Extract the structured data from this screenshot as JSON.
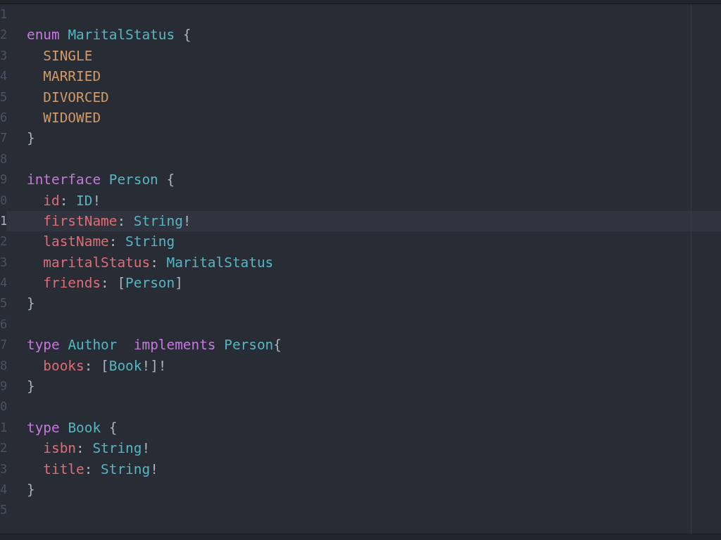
{
  "editor": {
    "lines": [
      {
        "number": "1",
        "highlighted": false
      },
      {
        "number": "2",
        "highlighted": false,
        "tokens": [
          {
            "kind": "keyword",
            "text": "enum"
          },
          {
            "kind": "type",
            "text": " MaritalStatus"
          },
          {
            "kind": "punct",
            "text": " {"
          }
        ]
      },
      {
        "number": "3",
        "highlighted": false,
        "tokens": [
          {
            "kind": "enumvalue",
            "text": "  SINGLE"
          }
        ]
      },
      {
        "number": "4",
        "highlighted": false,
        "tokens": [
          {
            "kind": "enumvalue",
            "text": "  MARRIED"
          }
        ]
      },
      {
        "number": "5",
        "highlighted": false,
        "tokens": [
          {
            "kind": "enumvalue",
            "text": "  DIVORCED"
          }
        ]
      },
      {
        "number": "6",
        "highlighted": false,
        "tokens": [
          {
            "kind": "enumvalue",
            "text": "  WIDOWED"
          }
        ]
      },
      {
        "number": "7",
        "highlighted": false,
        "tokens": [
          {
            "kind": "punct",
            "text": "}"
          }
        ]
      },
      {
        "number": "8",
        "highlighted": false
      },
      {
        "number": "9",
        "highlighted": false,
        "tokens": [
          {
            "kind": "keyword",
            "text": "interface"
          },
          {
            "kind": "type",
            "text": " Person"
          },
          {
            "kind": "punct",
            "text": " {"
          }
        ]
      },
      {
        "number": "0",
        "highlighted": false,
        "tokens": [
          {
            "kind": "field",
            "text": "  id"
          },
          {
            "kind": "punct",
            "text": ":"
          },
          {
            "kind": "type",
            "text": " ID"
          },
          {
            "kind": "punct",
            "text": "!"
          }
        ]
      },
      {
        "number": "1",
        "highlighted": true,
        "tokens": [
          {
            "kind": "field",
            "text": "  firstName"
          },
          {
            "kind": "punct",
            "text": ":"
          },
          {
            "kind": "type",
            "text": " String"
          },
          {
            "kind": "punct",
            "text": "!"
          }
        ]
      },
      {
        "number": "2",
        "highlighted": false,
        "tokens": [
          {
            "kind": "field",
            "text": "  lastName"
          },
          {
            "kind": "punct",
            "text": ":"
          },
          {
            "kind": "type",
            "text": " String"
          }
        ]
      },
      {
        "number": "3",
        "highlighted": false,
        "tokens": [
          {
            "kind": "field",
            "text": "  maritalStatus"
          },
          {
            "kind": "punct",
            "text": ":"
          },
          {
            "kind": "type",
            "text": " MaritalStatus"
          }
        ]
      },
      {
        "number": "4",
        "highlighted": false,
        "tokens": [
          {
            "kind": "field",
            "text": "  friends"
          },
          {
            "kind": "punct",
            "text": ": ["
          },
          {
            "kind": "type",
            "text": "Person"
          },
          {
            "kind": "punct",
            "text": "]"
          }
        ]
      },
      {
        "number": "5",
        "highlighted": false,
        "tokens": [
          {
            "kind": "punct",
            "text": "}"
          }
        ]
      },
      {
        "number": "6",
        "highlighted": false
      },
      {
        "number": "7",
        "highlighted": false,
        "tokens": [
          {
            "kind": "keyword",
            "text": "type"
          },
          {
            "kind": "type",
            "text": " Author"
          },
          {
            "kind": "keyword",
            "text": "  implements"
          },
          {
            "kind": "type",
            "text": " Person"
          },
          {
            "kind": "punct",
            "text": "{"
          }
        ]
      },
      {
        "number": "8",
        "highlighted": false,
        "tokens": [
          {
            "kind": "field",
            "text": "  books"
          },
          {
            "kind": "punct",
            "text": ": ["
          },
          {
            "kind": "type",
            "text": "Book"
          },
          {
            "kind": "punct",
            "text": "!]!"
          }
        ]
      },
      {
        "number": "9",
        "highlighted": false,
        "tokens": [
          {
            "kind": "punct",
            "text": "}"
          }
        ]
      },
      {
        "number": "0",
        "highlighted": false
      },
      {
        "number": "1",
        "highlighted": false,
        "tokens": [
          {
            "kind": "keyword",
            "text": "type"
          },
          {
            "kind": "type",
            "text": " Book"
          },
          {
            "kind": "punct",
            "text": " {"
          }
        ]
      },
      {
        "number": "2",
        "highlighted": false,
        "tokens": [
          {
            "kind": "field",
            "text": "  isbn"
          },
          {
            "kind": "punct",
            "text": ":"
          },
          {
            "kind": "type",
            "text": " String"
          },
          {
            "kind": "punct",
            "text": "!"
          }
        ]
      },
      {
        "number": "3",
        "highlighted": false,
        "tokens": [
          {
            "kind": "field",
            "text": "  title"
          },
          {
            "kind": "punct",
            "text": ":"
          },
          {
            "kind": "type",
            "text": " String"
          },
          {
            "kind": "punct",
            "text": "!"
          }
        ]
      },
      {
        "number": "4",
        "highlighted": false,
        "tokens": [
          {
            "kind": "punct",
            "text": "}"
          }
        ]
      },
      {
        "number": "5",
        "highlighted": false
      }
    ]
  }
}
